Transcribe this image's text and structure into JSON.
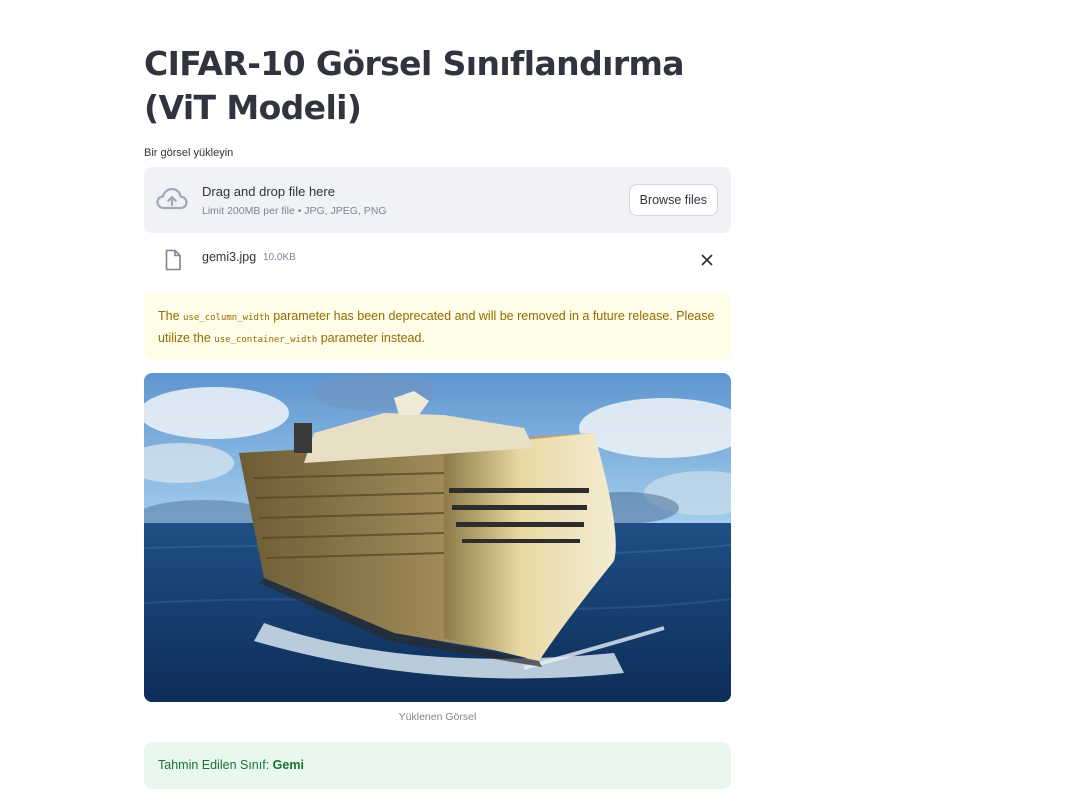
{
  "title": "CIFAR-10 Görsel Sınıflandırma (ViT Modeli)",
  "uploader": {
    "label": "Bir görsel yükleyin",
    "dropzone_title": "Drag and drop file here",
    "dropzone_limit": "Limit 200MB per file • JPG, JPEG, PNG",
    "browse_label": "Browse files",
    "icon": "cloud-upload-icon"
  },
  "uploaded_file": {
    "name": "gemi3.jpg",
    "size": "10.0KB",
    "icon": "file-icon",
    "remove_icon": "close-icon"
  },
  "warning": {
    "text_before": "The ",
    "code1": "use_column_width",
    "text_middle": " parameter has been deprecated and will be removed in a future release. Please utilize the ",
    "code2": "use_container_width",
    "text_after": " parameter instead."
  },
  "image": {
    "caption": "Yüklenen Görsel",
    "subject": "cruise ship on the ocean"
  },
  "result": {
    "label": "Tahmin Edilen Sınıf: ",
    "value": "Gemi"
  },
  "colors": {
    "text": "#31333f",
    "muted": "#808495",
    "dropzone_bg": "#f0f2f6",
    "warning_bg": "#fffce7",
    "warning_text": "#926c05",
    "success_bg": "#e8f8ee",
    "success_text": "#177233"
  }
}
